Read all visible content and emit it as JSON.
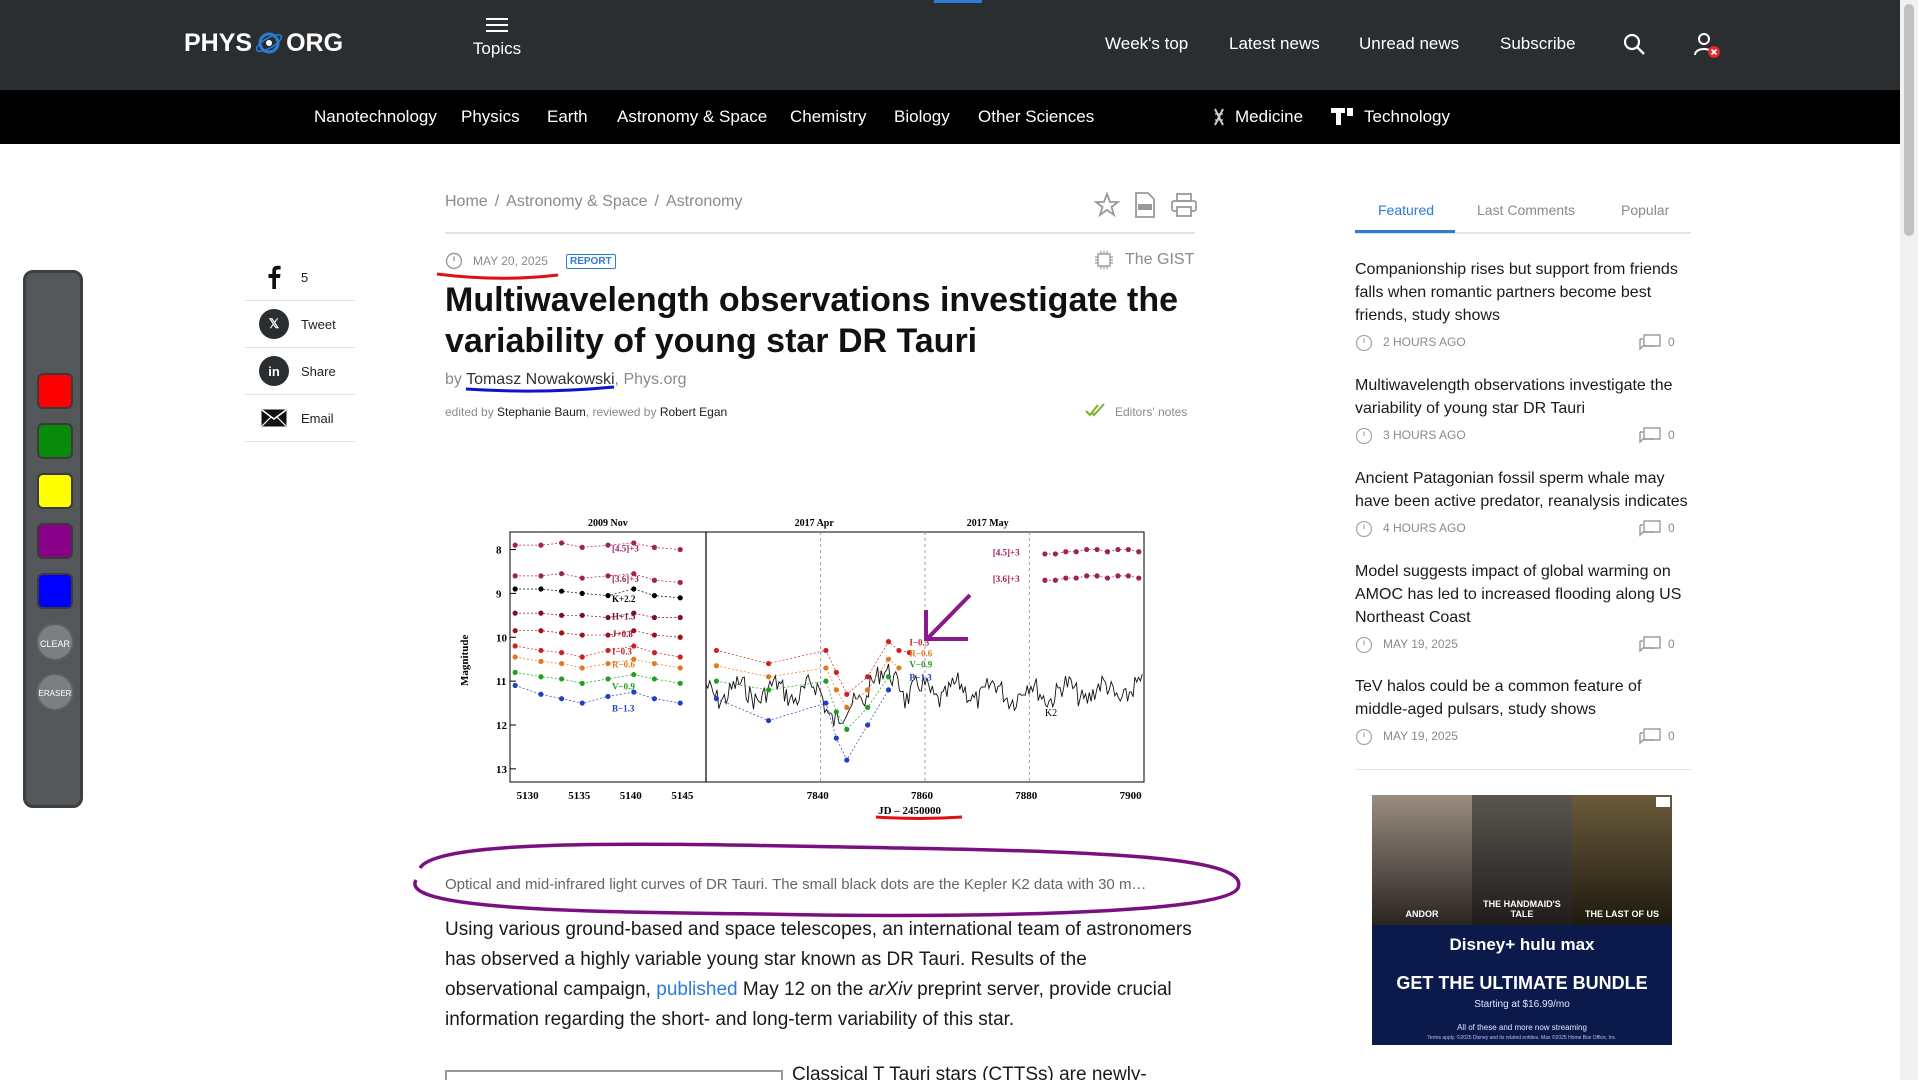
{
  "header": {
    "logo_left": "PHYS",
    "logo_right": "ORG",
    "topics_label": "Topics",
    "nav": [
      "Week's top",
      "Latest news",
      "Unread news",
      "Subscribe"
    ]
  },
  "categories": [
    "Nanotechnology",
    "Physics",
    "Earth",
    "Astronomy & Space",
    "Chemistry",
    "Biology",
    "Other Sciences",
    "Medicine",
    "Technology"
  ],
  "palette": {
    "colors": [
      "#ff0000",
      "#0a8a0a",
      "#ffff00",
      "#880088",
      "#0000ff"
    ],
    "clear_label": "CLEAR",
    "eraser_label": "ERASER"
  },
  "share": [
    {
      "label": "5",
      "icon": "facebook-icon"
    },
    {
      "label": "Tweet",
      "icon": "x-icon"
    },
    {
      "label": "Share",
      "icon": "linkedin-icon"
    },
    {
      "label": "Email",
      "icon": "email-icon"
    }
  ],
  "article": {
    "breadcrumb": [
      "Home",
      "Astronomy & Space",
      "Astronomy"
    ],
    "date": "MAY 20, 2025",
    "badge": "REPORT",
    "gist": "The GIST",
    "title": "Multiwavelength observations investigate the variability of young star DR Tauri",
    "by": "by",
    "author": "Tomasz Nowakowski",
    "source": "Phys.org",
    "edited_by_label": "edited by",
    "editor": "Stephanie Baum",
    "reviewed_by_label": "reviewed by",
    "reviewer": "Robert Egan",
    "editors_notes": "Editors' notes",
    "caption": "Optical and mid-infrared light curves of DR Tauri. The small black dots are the Kepler K2 data with 30 m…",
    "body_1": "Using various ground-based and space telescopes, an international team of astronomers has observed a highly variable young star known as DR Tauri. Results of the observational campaign, ",
    "body_link": "published",
    "body_2": " May 12 on the ",
    "body_italic": "arXiv",
    "body_3": " preprint server, provide crucial information regarding the short- and long-term variability of this star.",
    "body_next": "Classical T Tauri stars (CTTSs) are newly-"
  },
  "chart_data": {
    "type": "scatter",
    "title": "",
    "xlabel": "JD – 2450000",
    "ylabel": "Magnitude",
    "ylim": [
      13.3,
      7.6
    ],
    "panels": [
      {
        "label": "2009 Nov",
        "xlim": [
          5128,
          5147
        ],
        "xticks": [
          5130,
          5135,
          5140,
          5145
        ]
      },
      {
        "label": "2017 Apr",
        "xlim": [
          7818,
          7902
        ],
        "xticks": [
          7840,
          7860,
          7880,
          7900
        ]
      },
      {
        "label": "2017 May",
        "xlim": [
          7818,
          7902
        ]
      }
    ],
    "yticks": [
      8,
      9,
      10,
      11,
      12,
      13
    ],
    "series_labels_left": [
      "[4.5]+3",
      "[3.6]+3",
      "K+2.2",
      "H+1.5",
      "J+0.8",
      "I−0.3",
      "R−0.6",
      "V−0.9",
      "B−1.3"
    ],
    "series_labels_right": [
      "I−0.3",
      "R−0.6",
      "V−0.9",
      "B−1.3"
    ],
    "series_labels_ir": [
      "[4.5]+3",
      "[3.6]+3"
    ],
    "k2_label": "K2",
    "series": [
      {
        "name": "[4.5]+3",
        "color": "#a0205a",
        "x": [
          5128.5,
          5131,
          5133,
          5135,
          5137.5,
          5140,
          5142,
          5144.5
        ],
        "y": [
          7.9,
          7.9,
          7.85,
          7.95,
          7.9,
          7.85,
          7.95,
          8.0
        ]
      },
      {
        "name": "[3.6]+3",
        "color": "#a0205a",
        "x": [
          5128.5,
          5131,
          5133,
          5135,
          5137.5,
          5140,
          5142,
          5144.5
        ],
        "y": [
          8.6,
          8.6,
          8.55,
          8.65,
          8.6,
          8.55,
          8.7,
          8.75
        ]
      },
      {
        "name": "K+2.2",
        "color": "#000000",
        "x": [
          5128.5,
          5131,
          5133,
          5135,
          5137.5,
          5140,
          5142,
          5144.5
        ],
        "y": [
          8.9,
          8.9,
          8.95,
          9.0,
          9.05,
          8.9,
          9.05,
          9.1
        ]
      },
      {
        "name": "H+1.5",
        "color": "#7a0f2a",
        "x": [
          5128.5,
          5131,
          5133,
          5135,
          5137.5,
          5140,
          5142,
          5144.5
        ],
        "y": [
          9.45,
          9.45,
          9.5,
          9.5,
          9.55,
          9.45,
          9.55,
          9.55
        ]
      },
      {
        "name": "J+0.8",
        "color": "#a01020",
        "x": [
          5128.5,
          5131,
          5133,
          5135,
          5137.5,
          5140,
          5142,
          5144.5
        ],
        "y": [
          9.85,
          9.85,
          9.9,
          9.95,
          9.95,
          9.85,
          9.95,
          10.0
        ]
      },
      {
        "name": "I−0.3",
        "color": "#d02020",
        "x": [
          5128.5,
          5131,
          5133,
          5135,
          5137.5,
          5140,
          5142,
          5144.5,
          7820,
          7830,
          7841,
          7843,
          7845,
          7849,
          7853,
          7855,
          7857
        ],
        "y": [
          10.2,
          10.3,
          10.35,
          10.45,
          10.3,
          10.2,
          10.35,
          10.45,
          10.3,
          10.6,
          10.3,
          10.8,
          11.3,
          10.9,
          10.1,
          10.3,
          10.35
        ]
      },
      {
        "name": "R−0.6",
        "color": "#e07a20",
        "x": [
          5128.5,
          5131,
          5133,
          5135,
          5137.5,
          5140,
          5142,
          5144.5,
          7820,
          7830,
          7841,
          7843,
          7845,
          7849,
          7853,
          7855
        ],
        "y": [
          10.45,
          10.55,
          10.6,
          10.7,
          10.6,
          10.5,
          10.6,
          10.7,
          10.65,
          10.9,
          10.7,
          11.2,
          11.6,
          11.2,
          10.5,
          10.7
        ]
      },
      {
        "name": "V−0.9",
        "color": "#20a020",
        "x": [
          5128.5,
          5131,
          5133,
          5135,
          5137.5,
          5140,
          5142,
          5144.5,
          7820,
          7830,
          7841,
          7843,
          7845,
          7849,
          7853
        ],
        "y": [
          10.8,
          10.9,
          10.95,
          11.05,
          10.95,
          10.85,
          10.95,
          11.05,
          11.0,
          11.2,
          11.0,
          11.7,
          12.1,
          11.6,
          10.9
        ]
      },
      {
        "name": "B−1.3",
        "color": "#2040c0",
        "x": [
          5128.5,
          5131,
          5133,
          5135,
          5137.5,
          5140,
          5142,
          5144.5,
          7820,
          7830,
          7841,
          7843,
          7845,
          7849,
          7853
        ],
        "y": [
          11.1,
          11.3,
          11.4,
          11.5,
          11.35,
          11.25,
          11.4,
          11.5,
          11.4,
          11.9,
          11.5,
          12.3,
          12.8,
          12.0,
          11.2
        ]
      },
      {
        "name": "[4.5]+3 (May)",
        "color": "#a0205a",
        "x": [
          7883,
          7885,
          7887,
          7889,
          7891,
          7893,
          7895,
          7897,
          7899,
          7901
        ],
        "y": [
          8.1,
          8.1,
          8.05,
          8.05,
          8.0,
          8.0,
          8.05,
          8.0,
          8.0,
          8.05
        ]
      },
      {
        "name": "[3.6]+3 (May)",
        "color": "#a0205a",
        "x": [
          7883,
          7885,
          7887,
          7889,
          7891,
          7893,
          7895,
          7897,
          7899,
          7901
        ],
        "y": [
          8.7,
          8.7,
          8.65,
          8.65,
          8.6,
          8.6,
          8.65,
          8.6,
          8.6,
          8.65
        ]
      }
    ]
  },
  "sidebar": {
    "tabs": [
      "Featured",
      "Last Comments",
      "Popular"
    ],
    "items": [
      {
        "title": "Companionship rises but support from friends falls when romantic partners become best friends, study shows",
        "time": "2 HOURS AGO",
        "comments": "0"
      },
      {
        "title": "Multiwavelength observations investigate the variability of young star DR Tauri",
        "time": "3 HOURS AGO",
        "comments": "0"
      },
      {
        "title": "Ancient Patagonian fossil sperm whale may have been active predator, reanalysis indicates",
        "time": "4 HOURS AGO",
        "comments": "0"
      },
      {
        "title": "Model suggests impact of global warming on AMOC has led to increased flooding along US Northeast Coast",
        "time": "MAY 19, 2025",
        "comments": "0"
      },
      {
        "title": "TeV halos could be a common feature of middle-aged pulsars, study shows",
        "time": "MAY 19, 2025",
        "comments": "0"
      }
    ]
  },
  "ad": {
    "poster_1": "ANDOR",
    "poster_2": "THE HANDMAID'S TALE",
    "poster_3": "THE LAST OF US",
    "brands": "Disney+  hulu  max",
    "headline": "GET THE ULTIMATE BUNDLE",
    "price": "Starting at $16.99/mo",
    "note": "All of these and more now streaming",
    "fine": "Terms apply. ©2025 Disney and its related entities. Max ©2025 Home Box Office, Inc."
  }
}
